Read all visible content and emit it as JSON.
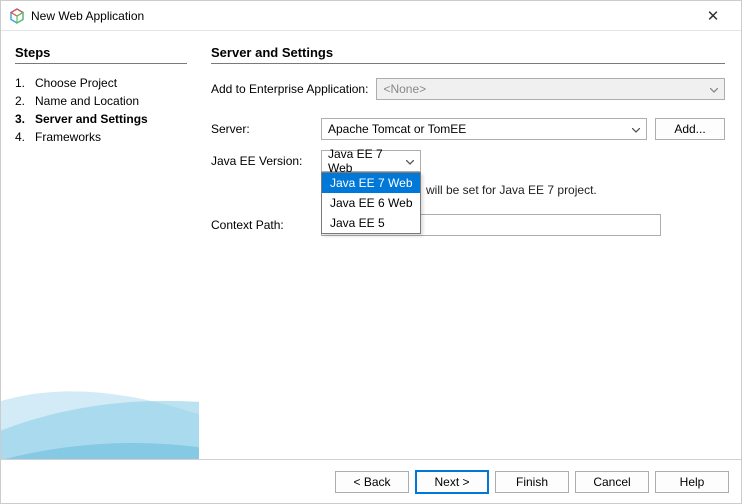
{
  "window": {
    "title": "New Web Application"
  },
  "sidebar": {
    "heading": "Steps",
    "items": [
      {
        "num": "1.",
        "label": "Choose Project"
      },
      {
        "num": "2.",
        "label": "Name and Location"
      },
      {
        "num": "3.",
        "label": "Server and Settings"
      },
      {
        "num": "4.",
        "label": "Frameworks"
      }
    ],
    "active_index": 2
  },
  "main": {
    "heading": "Server and Settings",
    "enterprise": {
      "label": "Add to Enterprise Application:",
      "value": "<None>"
    },
    "server": {
      "label": "Server:",
      "value": "Apache Tomcat or TomEE",
      "add_button": "Add..."
    },
    "javaee": {
      "label": "Java EE Version:",
      "value": "Java EE 7 Web",
      "options": [
        "Java EE 7 Web",
        "Java EE 6 Web",
        "Java EE 5"
      ],
      "selected_index": 0
    },
    "source_note": " will be set for Java EE 7 project.",
    "context_path": {
      "label": "Context Path:",
      "value": ""
    }
  },
  "footer": {
    "back": "< Back",
    "next": "Next >",
    "finish": "Finish",
    "cancel": "Cancel",
    "help": "Help"
  },
  "colors": {
    "accent": "#0078d7",
    "swoosh": "#7fbfe0"
  }
}
